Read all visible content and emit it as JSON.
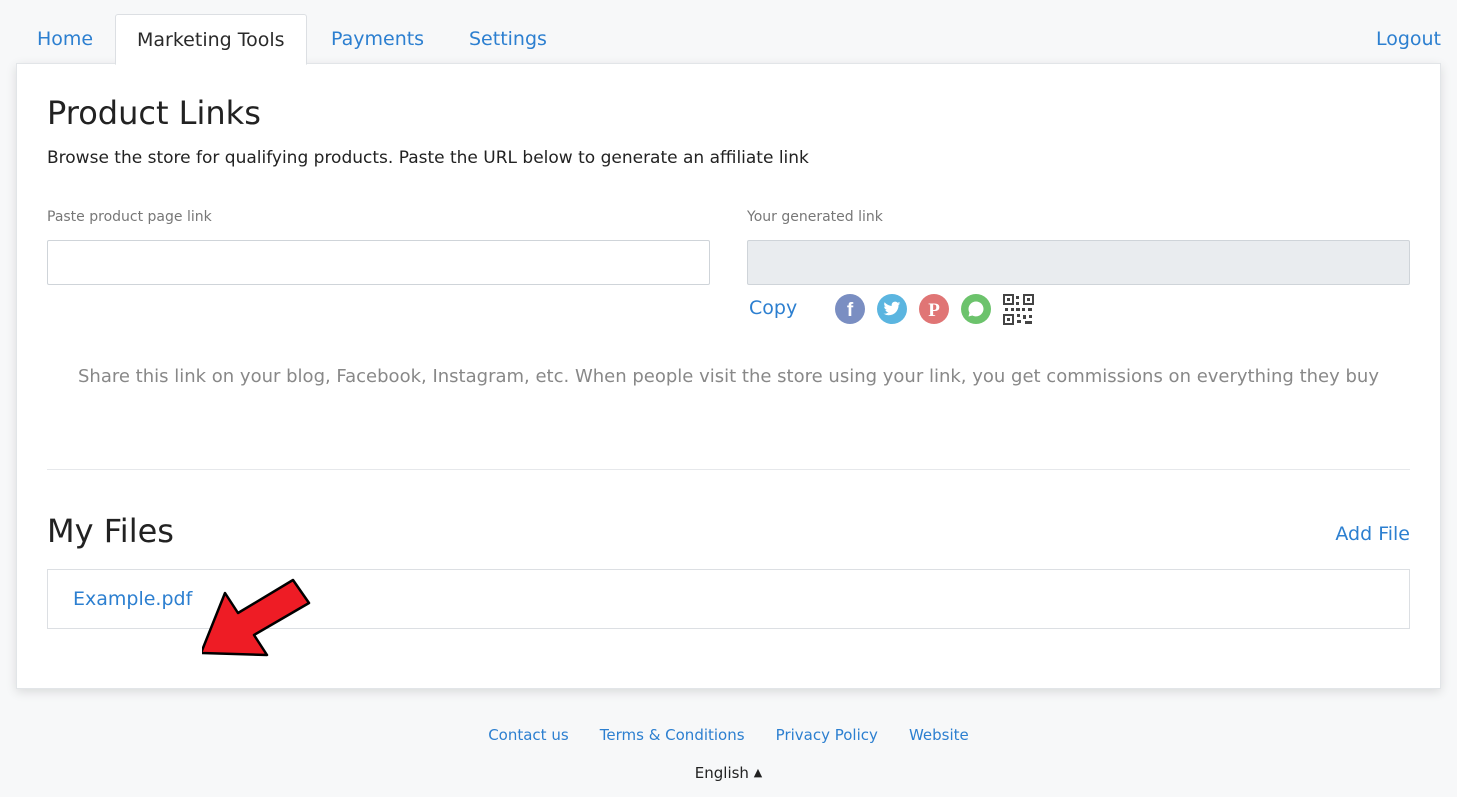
{
  "nav": {
    "tabs": [
      {
        "label": "Home"
      },
      {
        "label": "Marketing Tools"
      },
      {
        "label": "Payments"
      },
      {
        "label": "Settings"
      }
    ],
    "logout_label": "Logout"
  },
  "product_links": {
    "title": "Product Links",
    "subtitle": "Browse the store for qualifying products. Paste the URL below to generate an affiliate link",
    "paste_label": "Paste product page link",
    "paste_value": "",
    "generated_label": "Your generated link",
    "generated_value": "",
    "copy_label": "Copy",
    "share_icons": [
      "facebook-icon",
      "twitter-icon",
      "pinterest-icon",
      "whatsapp-icon",
      "qr-code-icon"
    ],
    "note": "Share this link on your blog, Facebook, Instagram, etc. When people visit the store using your link, you get commissions on everything they buy"
  },
  "my_files": {
    "title": "My Files",
    "add_label": "Add File",
    "files": [
      {
        "name": "Example.pdf"
      }
    ]
  },
  "footer": {
    "links": [
      {
        "label": "Contact us"
      },
      {
        "label": "Terms & Conditions"
      },
      {
        "label": "Privacy Policy"
      },
      {
        "label": "Website"
      }
    ],
    "language": "English"
  },
  "colors": {
    "link": "#2c7fd0",
    "facebook": "#7a8ec2",
    "twitter": "#5bb5e0",
    "pinterest": "#e07575",
    "whatsapp": "#6cc36c",
    "arrow": "#ee1c25"
  }
}
